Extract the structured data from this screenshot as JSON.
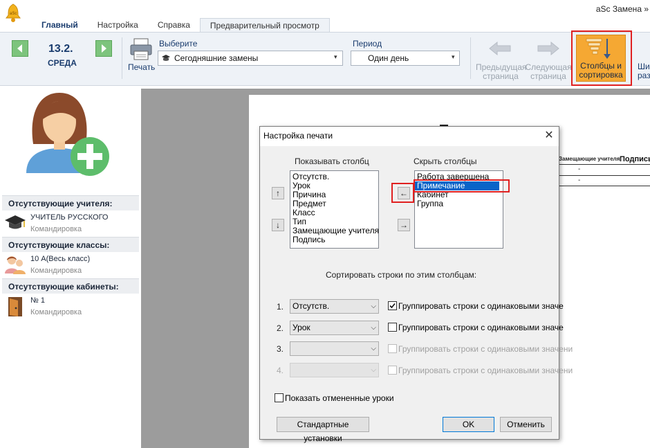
{
  "app": {
    "title": "aSc Замена »",
    "bell_label": "aSc"
  },
  "tabs": [
    "Главный",
    "Настройка",
    "Справка",
    "Предварительный просмотр"
  ],
  "ribbon": {
    "date_day": "13.2.",
    "date_weekday": "СРЕДА",
    "print_label": "Печать",
    "select_label": "Выберите",
    "select_value": "Сегодняшние замены",
    "period_label": "Период",
    "period_value": "Один день",
    "prev_page": [
      "Предыдущая",
      "страница"
    ],
    "next_page": [
      "Следующая",
      "страница"
    ],
    "cols_sort": [
      "Столбцы и",
      "сортировка"
    ],
    "more": [
      "Ши",
      "размер"
    ]
  },
  "left": {
    "absent_teachers_hdr": "Отсутствующие учителя:",
    "teacher_name": "УЧИТЕЛЬ РУССКОГО",
    "teacher_reason": "Командировка",
    "absent_classes_hdr": "Отсутствующие классы:",
    "class_name": "10 А(Весь класс)",
    "class_reason": "Командировка",
    "absent_rooms_hdr": "Отсутствующие  кабинеты:",
    "room_name": "№ 1",
    "room_reason": "Командировка"
  },
  "paper": {
    "col_substitute": "Замещающие учителя",
    "col_sign": "Подпись",
    "dash": "-"
  },
  "dialog": {
    "title": "Настройка печати",
    "close": "✕",
    "show_cols_label": "Показывать столбц",
    "hide_cols_label": "Скрыть столбцы",
    "show_cols": [
      "Отсутств.",
      "Урок",
      "Причина",
      "Предмет",
      "Класс",
      "Тип",
      "Замещающие учителя",
      "Подпись"
    ],
    "hide_cols": [
      "Работа завершена",
      "Примечание",
      "Кабинет",
      "Группа"
    ],
    "up": "↑",
    "down": "↓",
    "left": "←",
    "right": "→",
    "sort_label": "Сортировать строки по этим столбцам:",
    "sort_rows": [
      {
        "num": "1.",
        "value": "Отсутств.",
        "group_label": "Группировать строки с одинаковыми значе",
        "checked": true
      },
      {
        "num": "2.",
        "value": "Урок",
        "group_label": "Группировать строки с одинаковыми значе",
        "checked": false
      },
      {
        "num": "3.",
        "value": "",
        "group_label": "Группировать строки с одинаковыми значени",
        "checked": false
      },
      {
        "num": "4.",
        "value": "",
        "group_label": "Группировать строки с одинаковыми значени",
        "checked": false
      }
    ],
    "show_cancelled": "Показать отмененные уроки",
    "defaults_btn": "Стандартные установки",
    "ok_btn": "OK",
    "cancel_btn": "Отменить"
  }
}
